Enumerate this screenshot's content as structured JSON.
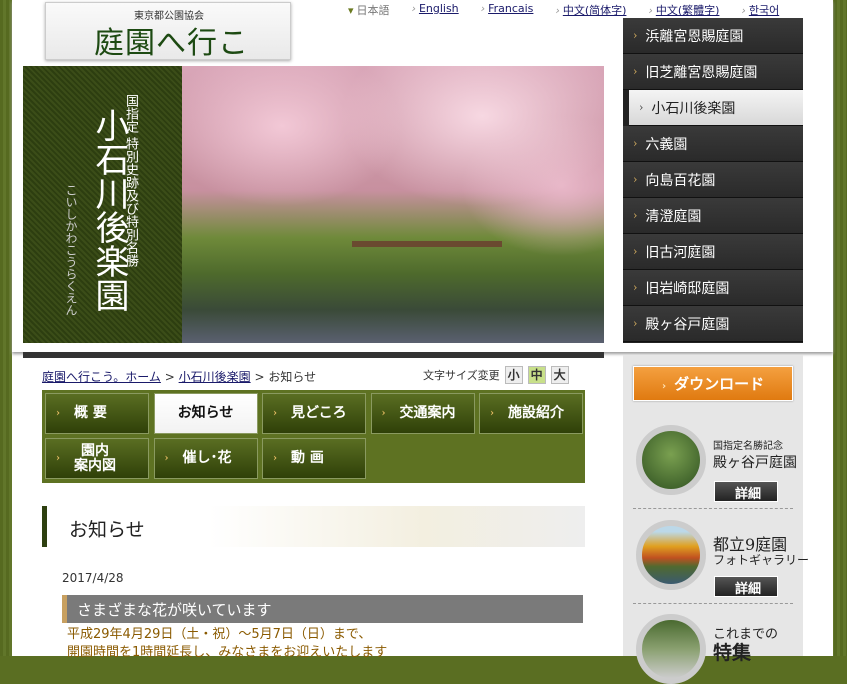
{
  "header": {
    "logo_sub": "東京都公園協会",
    "logo_main": "庭園へ行こう。",
    "languages": [
      {
        "label": "日本語",
        "current": true
      },
      {
        "label": "English"
      },
      {
        "label": "Francais"
      },
      {
        "label": "中文(简体字)"
      },
      {
        "label": "中文(繁體字)"
      },
      {
        "label": "한국어"
      }
    ]
  },
  "hero": {
    "designation": "国指定 特別史跡及び特別名勝",
    "name": "小石川後楽園",
    "reading": "こいしかわこうらくえん"
  },
  "gardens": [
    {
      "label": "浜離宮恩賜庭園"
    },
    {
      "label": "旧芝離宮恩賜庭園"
    },
    {
      "label": "小石川後楽園",
      "selected": true
    },
    {
      "label": "六義園"
    },
    {
      "label": "向島百花園"
    },
    {
      "label": "清澄庭園"
    },
    {
      "label": "旧古河庭園"
    },
    {
      "label": "旧岩崎邸庭園"
    },
    {
      "label": "殿ヶ谷戸庭園"
    }
  ],
  "breadcrumb": [
    "庭園へ行こう。ホーム",
    "小石川後楽園",
    "お知らせ"
  ],
  "font_size": {
    "label": "文字サイズ変更",
    "options": [
      "小",
      "中",
      "大"
    ],
    "selected": "中"
  },
  "tabs": [
    {
      "label": "概 要"
    },
    {
      "label": "お知らせ",
      "selected": true
    },
    {
      "label": "見どころ"
    },
    {
      "label": "交通案内"
    },
    {
      "label": "施設紹介"
    },
    {
      "label": "園内\n案内図"
    },
    {
      "label": "催し･花"
    },
    {
      "label": "動 画"
    }
  ],
  "section_title": "お知らせ",
  "news": {
    "date": "2017/4/28",
    "title": "さまざまな花が咲いています",
    "lines": [
      "平成29年4月29日（土・祝）～5月7日（日）まで、",
      "開園時間を1時間延長し、みなさまをお迎えいたします"
    ]
  },
  "sidebar": {
    "download": "ダウンロード",
    "promo1": {
      "sub": "国指定名勝記念",
      "title": "殿ヶ谷戸庭園",
      "button": "詳細"
    },
    "promo2": {
      "title": "都立9庭園",
      "sub": "フォトギャラリー",
      "button": "詳細"
    },
    "promo3": {
      "sub": "これまでの",
      "title": "特集"
    }
  },
  "colors": {
    "olive": "#5e7222",
    "dark_nav": "#2a2a2a",
    "orange": "#e88a20",
    "news_text": "#8a5a00"
  }
}
